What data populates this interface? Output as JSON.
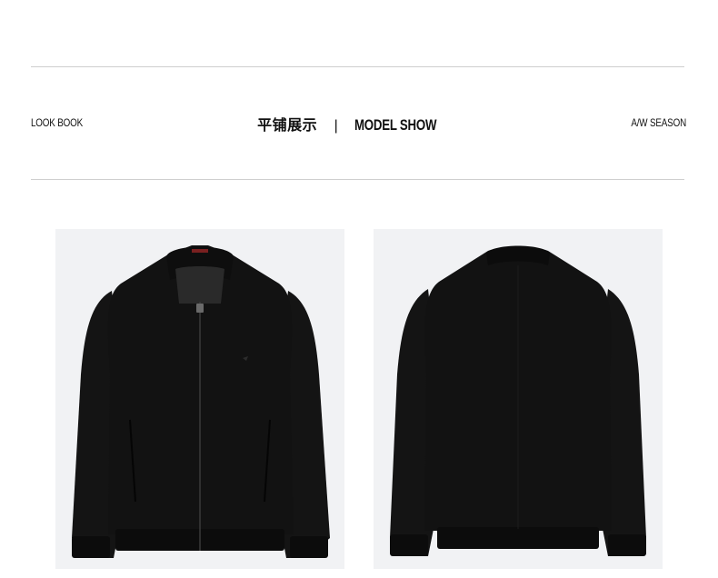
{
  "header": {
    "left_label": "LOOK BOOK",
    "title_cn": "平铺展示",
    "title_separator": "|",
    "title_en": "MODEL SHOW",
    "right_label": "A/W SEASON"
  },
  "colors": {
    "rule": "#cfcfcf",
    "photo_bg": "#f1f2f4",
    "garment": "#121212"
  },
  "gallery": [
    {
      "name": "jacket-front",
      "view": "front"
    },
    {
      "name": "jacket-back",
      "view": "back"
    }
  ]
}
